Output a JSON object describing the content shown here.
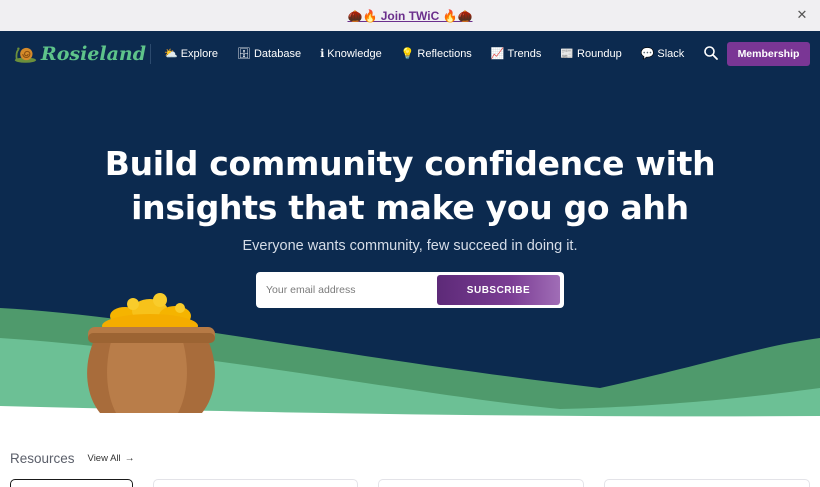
{
  "announcement": {
    "text": "🌰🔥 Join TWiC 🔥🌰",
    "close_icon": "close-icon"
  },
  "nav": {
    "brand": "Rosieland",
    "items": [
      {
        "emoji": "⛅",
        "label": "Explore"
      },
      {
        "emoji": "🗄",
        "label": "Database"
      },
      {
        "emoji": "ℹ",
        "label": "Knowledge"
      },
      {
        "emoji": "💡",
        "label": "Reflections"
      },
      {
        "emoji": "📈",
        "label": "Trends"
      },
      {
        "emoji": "📰",
        "label": "Roundup"
      },
      {
        "emoji": "💬",
        "label": "Slack"
      }
    ],
    "search_icon": "search-icon",
    "membership_label": "Membership"
  },
  "hero": {
    "title_line1": "Build community confidence with",
    "title_line2": "insights that make you go ahh",
    "subtitle": "Everyone wants community, few succeed in doing it.",
    "email_placeholder": "Your email address",
    "subscribe_label": "SUBSCRIBE"
  },
  "resources": {
    "title": "Resources",
    "view_all": "View All",
    "arrow": "→"
  },
  "colors": {
    "navy": "#0c2a4f",
    "purple": "#7a3695",
    "green": "#5ec48a",
    "hill_green": "#4f9a6c"
  }
}
